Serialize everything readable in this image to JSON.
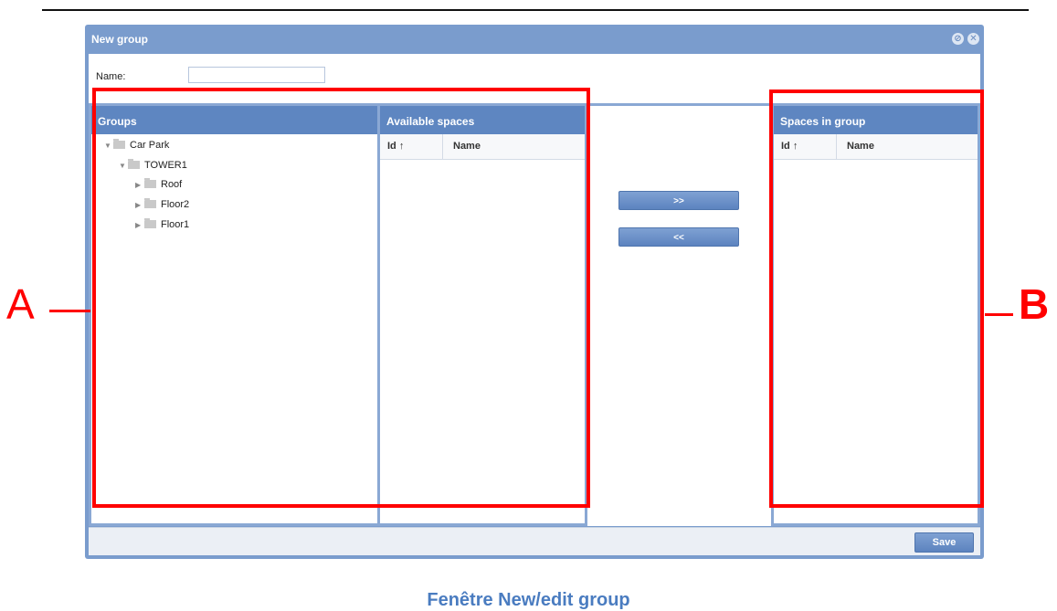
{
  "window": {
    "title": "New group"
  },
  "form": {
    "name_label": "Name:",
    "name_value": ""
  },
  "groups_panel": {
    "title": "Groups",
    "tree": [
      {
        "label": "Car Park",
        "expanded": true
      },
      {
        "label": "TOWER1",
        "expanded": true
      },
      {
        "label": "Roof",
        "expanded": false
      },
      {
        "label": "Floor2",
        "expanded": false
      },
      {
        "label": "Floor1",
        "expanded": false
      }
    ]
  },
  "available_panel": {
    "title": "Available spaces",
    "columns": [
      "Id ↑",
      "Name"
    ],
    "rows": []
  },
  "group_panel": {
    "title": "Spaces in group",
    "columns": [
      "Id ↑",
      "Name"
    ],
    "rows": []
  },
  "buttons": {
    "add": ">>",
    "remove": "<<",
    "save": "Save"
  },
  "annotations": {
    "a": "A",
    "b": "B"
  },
  "caption": "Fenêtre New/edit group",
  "colors": {
    "accent": "#5e86c1",
    "annotation": "#ff0000",
    "caption": "#4a7cc0"
  }
}
